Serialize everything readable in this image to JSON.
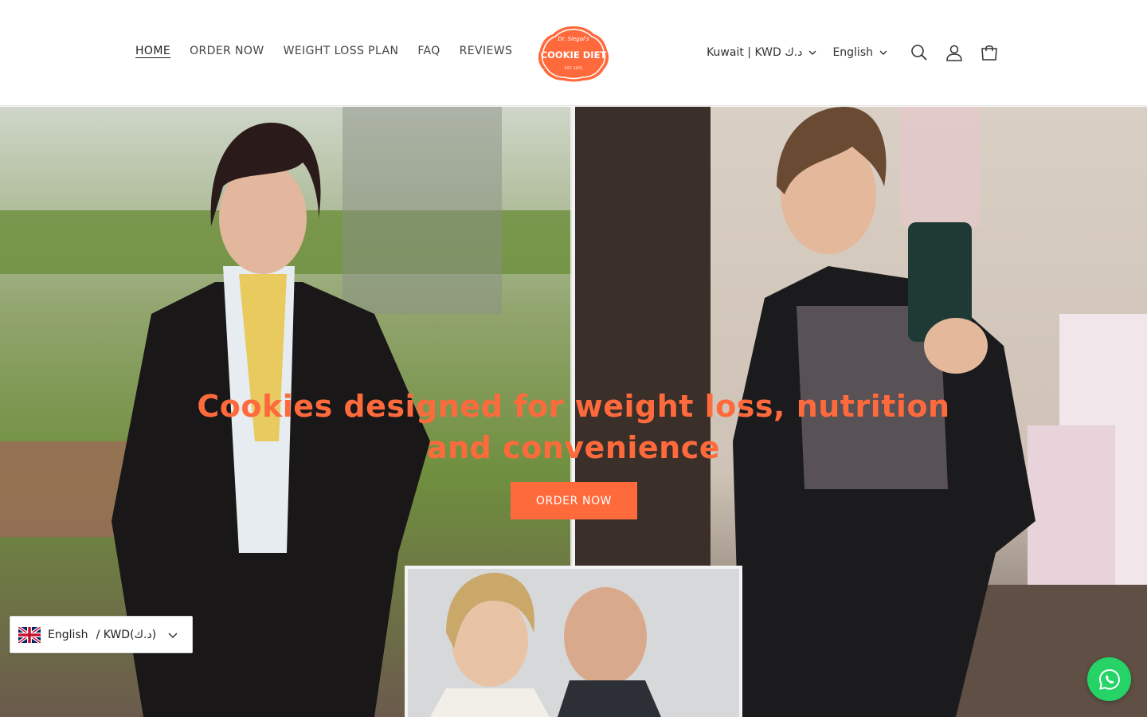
{
  "nav": {
    "items": [
      {
        "label": "HOME",
        "active": true
      },
      {
        "label": "ORDER NOW"
      },
      {
        "label": "WEIGHT LOSS PLAN"
      },
      {
        "label": "FAQ"
      },
      {
        "label": "REVIEWS"
      }
    ]
  },
  "logo": {
    "top_text": "Dr. Siegal's",
    "main_text": "COOKIE DIET",
    "bottom_text": "EST. 1975",
    "color": "#ff6a3d"
  },
  "header_tools": {
    "country_currency": "Kuwait | KWD د.ك",
    "language": "English",
    "icons": [
      "search-icon",
      "account-icon",
      "cart-icon"
    ]
  },
  "hero": {
    "title": "Cookies designed for weight loss, nutrition and convenience",
    "cta_label": "ORDER NOW",
    "accent": "#ff6a3d"
  },
  "language_widget": {
    "language": "English",
    "currency": "/ KWD(د.ك)",
    "flag": "uk-flag-icon"
  },
  "floating": {
    "icon": "whatsapp-icon",
    "color": "#25d366"
  }
}
